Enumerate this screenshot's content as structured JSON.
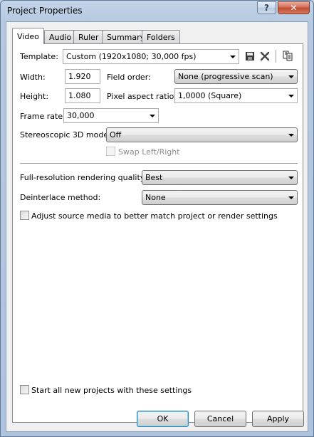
{
  "window": {
    "title": "Project Properties",
    "help_glyph": "?",
    "close_glyph": "✕"
  },
  "tabs": [
    {
      "label": "Video",
      "active": true
    },
    {
      "label": "Audio",
      "active": false
    },
    {
      "label": "Ruler",
      "active": false
    },
    {
      "label": "Summary",
      "active": false
    },
    {
      "label": "Folders",
      "active": false
    }
  ],
  "video": {
    "template_label": "Template:",
    "template_value": "Custom (1920x1080; 30,000 fps)",
    "width_label": "Width:",
    "width_value": "1.920",
    "field_order_label": "Field order:",
    "field_order_value": "None (progressive scan)",
    "height_label": "Height:",
    "height_value": "1.080",
    "pixel_aspect_label": "Pixel aspect ratio:",
    "pixel_aspect_value": "1,0000 (Square)",
    "frame_rate_label": "Frame rate:",
    "frame_rate_value": "30,000",
    "stereo_label": "Stereoscopic 3D mode:",
    "stereo_value": "Off",
    "swap_label": "Swap Left/Right",
    "quality_label": "Full-resolution rendering quality:",
    "quality_value": "Best",
    "deinterlace_label": "Deinterlace method:",
    "deinterlace_value": "None",
    "adjust_label": "Adjust source media to better match project or render settings",
    "start_all_label": "Start all new projects with these settings"
  },
  "buttons": {
    "ok": "OK",
    "cancel": "Cancel",
    "apply": "Apply"
  },
  "colors": {
    "delete_icon": "#444444",
    "default_button_border": "#3c7fb1"
  }
}
